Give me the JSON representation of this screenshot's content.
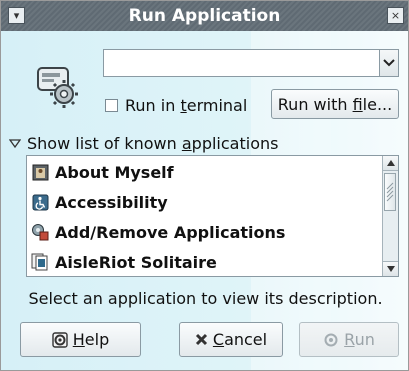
{
  "window": {
    "title": "Run Application",
    "menu_button_glyph": "▾",
    "close_button_glyph": "×"
  },
  "command": {
    "value": "",
    "placeholder": ""
  },
  "run_in_terminal": {
    "label_pre": "Run in ",
    "label_mnemonic": "t",
    "label_post": "erminal",
    "checked": false
  },
  "run_with_file": {
    "label_pre": "Run with ",
    "label_mnemonic": "f",
    "label_post": "ile..."
  },
  "known_apps": {
    "expander_pre": "Show list of known ",
    "expander_mnemonic": "a",
    "expander_post": "pplications",
    "items": [
      {
        "label": "About Myself",
        "icon": "id-card-icon"
      },
      {
        "label": "Accessibility",
        "icon": "accessibility-icon"
      },
      {
        "label": "Add/Remove Applications",
        "icon": "package-icon"
      },
      {
        "label": "AisleRiot Solitaire",
        "icon": "cards-icon"
      }
    ]
  },
  "description": "Select an application to view its description.",
  "buttons": {
    "help_mnemonic": "H",
    "help_post": "elp",
    "cancel_mnemonic": "C",
    "cancel_post": "ancel",
    "run_mnemonic": "R",
    "run_post": "un",
    "run_enabled": false
  },
  "colors": {
    "titlebar": "#5f6a73",
    "background": "#dff4f8",
    "disabled_text": "#9aa3a8"
  }
}
